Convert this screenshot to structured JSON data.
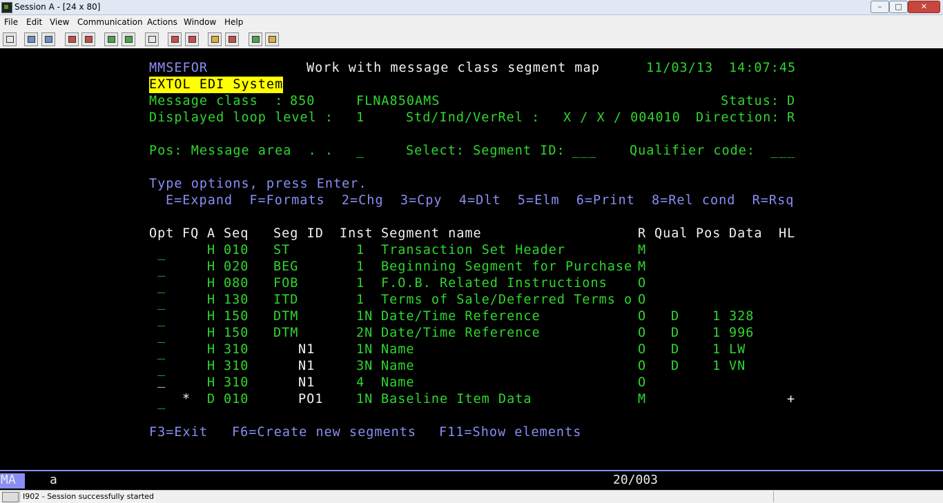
{
  "window": {
    "title": "Session A - [24 x 80]"
  },
  "menu": [
    "File",
    "Edit",
    "View",
    "Communication",
    "Actions",
    "Window",
    "Help"
  ],
  "toolbar_icons": [
    "print-screen-icon",
    "copy-icon",
    "paste-icon",
    "send-icon",
    "receive-icon",
    "display-icon",
    "keypad-icon",
    "macro-icon",
    "record-macro-icon",
    "play-macro-icon",
    "run-icon",
    "stop-icon",
    "globe-icon",
    "clipboard-icon"
  ],
  "screen": {
    "program": "MMSEFOR",
    "title": "Work with message class segment map",
    "date": "11/03/13",
    "time": "14:07:45",
    "system": "EXTOL EDI System",
    "message_class_label": "Message class  :",
    "message_class": "850",
    "message_class_name": "FLNA850AMS",
    "status_label": "Status:",
    "status": "D",
    "loop_label": "Displayed loop level :",
    "loop_level": "1",
    "std_label": "Std/Ind/VerRel :",
    "std_value": "X / X / 004010",
    "direction_label": "Direction:",
    "direction": "R",
    "pos_label": "Pos: Message area  . .",
    "pos_value": "_",
    "select_label": "Select: Segment ID:",
    "segment_id_value": "___",
    "qualifier_label": "Qualifier code:",
    "qualifier_value": "___",
    "instructions": "Type options, press Enter.",
    "options": "E=Expand  F=Formats  2=Chg  3=Cpy  4=Dlt  5=Elm  6=Print  8=Rel cond  R=Rsq",
    "columns": {
      "opt": "Opt",
      "fq": "FQ",
      "a": "A",
      "seq": "Seq",
      "segid": "Seg ID",
      "inst": "Inst",
      "name": "Segment name",
      "r": "R",
      "qual": "Qual",
      "pos": "Pos",
      "data": "Data",
      "hl": "HL"
    },
    "rows": [
      {
        "opt": "_",
        "fq": "",
        "a": "H",
        "seq": "010",
        "segid": "ST",
        "inst": "1",
        "name": "Transaction Set Header",
        "r": "M",
        "qual": "",
        "pos": "",
        "data": "",
        "hl": ""
      },
      {
        "opt": "_",
        "fq": "",
        "a": "H",
        "seq": "020",
        "segid": "BEG",
        "inst": "1",
        "name": "Beginning Segment for Purchase",
        "r": "M",
        "qual": "",
        "pos": "",
        "data": "",
        "hl": ""
      },
      {
        "opt": "_",
        "fq": "",
        "a": "H",
        "seq": "080",
        "segid": "FOB",
        "inst": "1",
        "name": "F.O.B. Related Instructions",
        "r": "O",
        "qual": "",
        "pos": "",
        "data": "",
        "hl": ""
      },
      {
        "opt": "_",
        "fq": "",
        "a": "H",
        "seq": "130",
        "segid": "ITD",
        "inst": "1",
        "name": "Terms of Sale/Deferred Terms o",
        "r": "O",
        "qual": "",
        "pos": "",
        "data": "",
        "hl": ""
      },
      {
        "opt": "_",
        "fq": "",
        "a": "H",
        "seq": "150",
        "segid": "DTM",
        "inst": "1N",
        "name": "Date/Time Reference",
        "r": "O",
        "qual": "D",
        "pos": "1",
        "data": "328",
        "hl": ""
      },
      {
        "opt": "_",
        "fq": "",
        "a": "H",
        "seq": "150",
        "segid": "DTM",
        "inst": "2N",
        "name": "Date/Time Reference",
        "r": "O",
        "qual": "D",
        "pos": "1",
        "data": "996",
        "hl": ""
      },
      {
        "opt": "_",
        "fq": "",
        "a": "H",
        "seq": "310",
        "segid": "N1",
        "inst": "1N",
        "name": "Name",
        "r": "O",
        "qual": "D",
        "pos": "1",
        "data": "LW",
        "hl": ""
      },
      {
        "opt": "_",
        "fq": "",
        "a": "H",
        "seq": "310",
        "segid": "N1",
        "inst": "3N",
        "name": "Name",
        "r": "O",
        "qual": "D",
        "pos": "1",
        "data": "VN",
        "hl": ""
      },
      {
        "opt": "_",
        "fq": "",
        "a": "H",
        "seq": "310",
        "segid": "N1",
        "inst": "4",
        "name": "Name",
        "r": "O",
        "qual": "",
        "pos": "",
        "data": "",
        "hl": ""
      },
      {
        "opt": "_",
        "fq": "*",
        "a": "D",
        "seq": "010",
        "segid": "PO1",
        "inst": "1N",
        "name": "Baseline Item Data",
        "r": "M",
        "qual": "",
        "pos": "",
        "data": "",
        "hl": "+"
      }
    ],
    "function_keys": [
      {
        "key": "F3=Exit"
      },
      {
        "key": "F6=Create new segments"
      },
      {
        "key": "F11=Show elements"
      }
    ]
  },
  "oia": {
    "mode": "MA",
    "indicator": "a",
    "cursor": "20/003"
  },
  "status_bar": {
    "message": "I902 - Session successfully started"
  }
}
